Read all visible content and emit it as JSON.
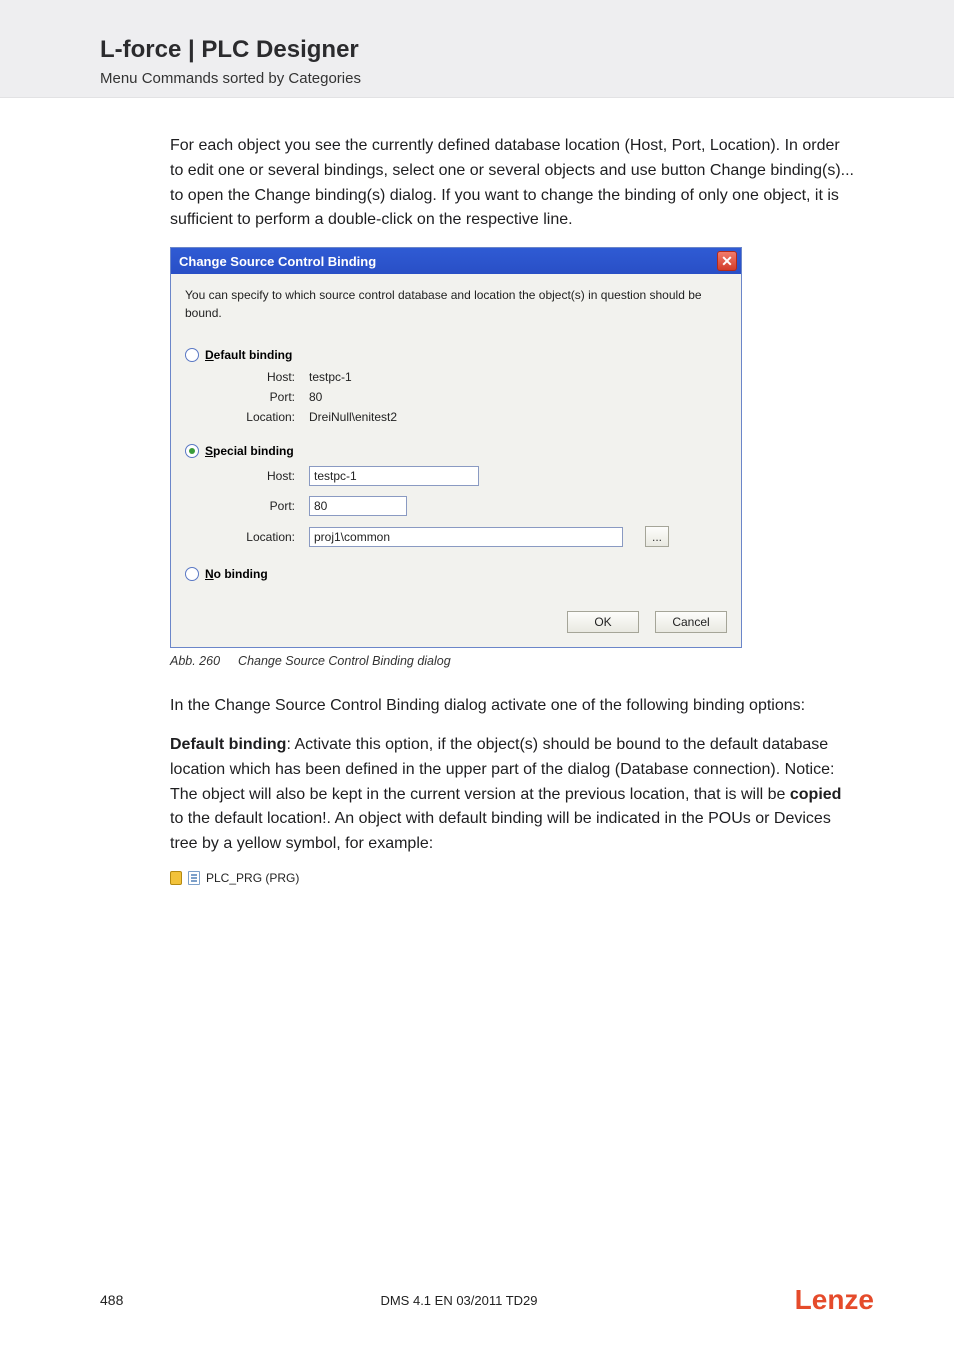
{
  "header": {
    "title": "L-force | PLC Designer",
    "subtitle": "Menu Commands sorted by Categories"
  },
  "para1": "For each object you see the currently defined database location (Host, Port, Location). In order to edit one or several bindings, select one or several objects and use button Change binding(s)... to open the Change binding(s) dialog. If you want to change the binding of only one object, it is sufficient to perform a double-click on the respective line.",
  "dialog": {
    "title": "Change Source Control Binding",
    "close": "✕",
    "desc": "You can specify to which source control database and location the object(s) in question should be bound.",
    "default": {
      "label_pre": "D",
      "label_rest": "efault binding",
      "host_label": "Host:",
      "host": "testpc-1",
      "port_label": "Port:",
      "port": "80",
      "location_label": "Location:",
      "location": "DreiNull\\enitest2"
    },
    "special": {
      "label_pre": "S",
      "label_rest": "pecial binding",
      "host_label": "Host:",
      "host": "testpc-1",
      "port_label": "Port:",
      "port": "80",
      "location_label": "Location:",
      "location": "proj1\\common",
      "browse": "..."
    },
    "nobinding": {
      "label_pre": "N",
      "label_rest": "o binding"
    },
    "ok": "OK",
    "cancel": "Cancel"
  },
  "caption": {
    "num": "Abb. 260",
    "text": "Change Source Control Binding dialog"
  },
  "para2": "In the Change Source Control Binding dialog activate one of the following binding options:",
  "para3_s1": "Default binding",
  "para3_rest_a": ": Activate this option, if  the object(s) should be bound to the default database location which has been defined in the upper part of the dialog (Database connection). Notice: The object will also be kept in the current version at the previous location, that is will be ",
  "para3_bold_mid": "copied",
  "para3_rest_b": " to the default location!. An object with default binding will be indicated in the POUs or Devices tree by a yellow symbol, for example:",
  "icon_example_text": "PLC_PRG (PRG)",
  "footer": {
    "page": "488",
    "docid": "DMS 4.1 EN 03/2011 TD29",
    "logo": "Lenze"
  },
  "chart_data": null
}
